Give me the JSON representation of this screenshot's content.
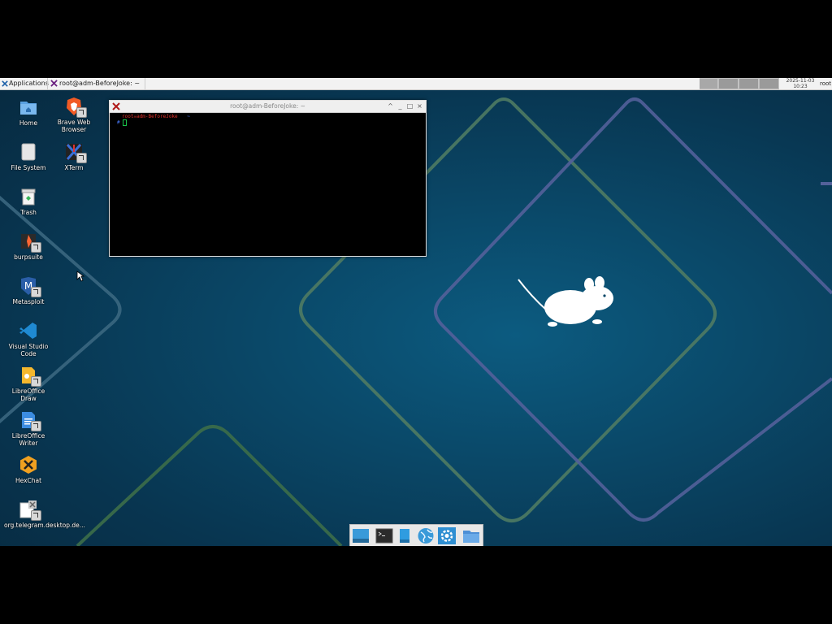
{
  "panel": {
    "applications_label": "Applications",
    "task_label": "root@adm-BeforeJoke: ~",
    "clock_date": "2025-11-03",
    "clock_time": "10:23",
    "user_label": "root"
  },
  "desktop_icons": [
    {
      "label": "Home",
      "icon": "home-folder-icon"
    },
    {
      "label": "Brave Web Browser",
      "icon": "brave-browser-icon"
    },
    {
      "label": "File System",
      "icon": "drive-icon"
    },
    {
      "label": "XTerm",
      "icon": "xterm-icon"
    },
    {
      "label": "Trash",
      "icon": "trash-icon"
    },
    {
      "label": "burpsuite",
      "icon": "burpsuite-icon"
    },
    {
      "label": "Metasploit",
      "icon": "metasploit-icon"
    },
    {
      "label": "Visual Studio Code",
      "icon": "vscode-icon"
    },
    {
      "label": "LibreOffice Draw",
      "icon": "libreoffice-draw-icon"
    },
    {
      "label": "LibreOffice Writer",
      "icon": "libreoffice-writer-icon"
    },
    {
      "label": "HexChat",
      "icon": "hexchat-icon"
    },
    {
      "label": "org.telegram.desktop.de...",
      "icon": "telegram-desktop-file-icon"
    }
  ],
  "terminal": {
    "title": "root@adm-BeforeJoke: ~",
    "prompt_user": "root",
    "prompt_host": "adm-BeforeJoke",
    "prompt_dir": "~",
    "prompt_symbol": "#",
    "controls": {
      "up": "^",
      "minimize": "_",
      "maximize": "□",
      "close": "×"
    }
  },
  "dock": [
    {
      "name": "show-desktop",
      "icon": "show-desktop-icon"
    },
    {
      "name": "terminal",
      "icon": "terminal-icon"
    },
    {
      "name": "file-manager",
      "icon": "file-manager-icon"
    },
    {
      "name": "web-browser",
      "icon": "globe-icon"
    },
    {
      "name": "settings",
      "icon": "gear-icon"
    },
    {
      "name": "folder",
      "icon": "folder-icon"
    }
  ],
  "colors": {
    "desktop_bg": "#0a4868",
    "panel_bg": "#f2f2f2",
    "prompt_red": "#e0302a",
    "prompt_blue": "#4a7cff",
    "cursor_green": "#19c34a"
  }
}
